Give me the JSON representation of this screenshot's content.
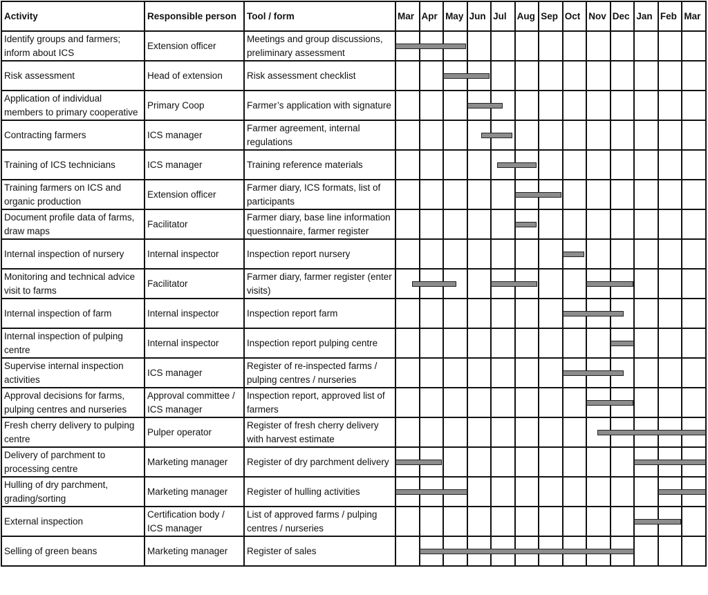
{
  "chart_data": {
    "type": "table",
    "subtype": "gantt",
    "columns": [
      "Activity",
      "Responsible person",
      "Tool / form"
    ],
    "months": [
      "Mar",
      "Apr",
      "May",
      "Jun",
      "Jul",
      "Aug",
      "Sep",
      "Oct",
      "Nov",
      "Dec",
      "Jan",
      "Feb",
      "Mar"
    ],
    "bar_color": "#8c8c8c",
    "rows": [
      {
        "activity": "Identify groups and farmers; inform about ICS",
        "person": "Extension officer",
        "tool": "Meetings and group discussions, preliminary assessment",
        "bars": [
          [
            0,
            2.95
          ]
        ]
      },
      {
        "activity": "Risk assessment",
        "person": "Head of extension",
        "tool": "Risk assessment checklist",
        "bars": [
          [
            2.0,
            3.95
          ]
        ]
      },
      {
        "activity": "Application of individual members to primary cooperative",
        "person": "Primary Coop",
        "tool": "Farmer’s application with signature",
        "bars": [
          [
            3.0,
            4.5
          ]
        ]
      },
      {
        "activity": "Contracting farmers",
        "person": "ICS manager",
        "tool": "Farmer agreement, internal regulations",
        "bars": [
          [
            3.6,
            4.9
          ]
        ]
      },
      {
        "activity": "Training of ICS technicians",
        "person": "ICS manager",
        "tool": "Training reference materials",
        "bars": [
          [
            4.25,
            5.9
          ]
        ]
      },
      {
        "activity": "Training farmers on ICS and organic production",
        "person": "Extension officer",
        "tool": "Farmer diary, ICS formats, list of participants",
        "bars": [
          [
            5.0,
            6.95
          ]
        ]
      },
      {
        "activity": "Document profile data of farms, draw maps",
        "person": "Facilitator",
        "tool": "Farmer diary, base line information questionnaire, farmer register",
        "bars": [
          [
            5.0,
            5.9
          ]
        ]
      },
      {
        "activity": "Internal inspection of nursery",
        "person": "Internal inspector",
        "tool": "Inspection report nursery",
        "bars": [
          [
            7.0,
            7.9
          ]
        ]
      },
      {
        "activity": "Monitoring and technical advice visit to farms",
        "person": "Facilitator",
        "tool": "Farmer diary, farmer register (enter visits)",
        "bars": [
          [
            0.7,
            2.55
          ],
          [
            4.0,
            5.95
          ],
          [
            8.0,
            9.95
          ]
        ]
      },
      {
        "activity": "Internal inspection of farm",
        "person": "Internal inspector",
        "tool": "Inspection report farm",
        "bars": [
          [
            7.0,
            9.55
          ]
        ]
      },
      {
        "activity": "Internal inspection of pulping centre",
        "person": "Internal inspector",
        "tool": "Inspection report pulping centre",
        "bars": [
          [
            9.0,
            10.0
          ]
        ]
      },
      {
        "activity": "Supervise internal inspection activities",
        "person": "ICS manager",
        "tool": "Register of re-inspected farms / pulping centres / nurseries",
        "bars": [
          [
            7.0,
            9.55
          ]
        ]
      },
      {
        "activity": "Approval decisions for farms, pulping centres and nurseries",
        "person": "Approval committee / ICS manager",
        "tool": "Inspection report, approved list of farmers",
        "bars": [
          [
            8.0,
            9.95
          ]
        ]
      },
      {
        "activity": "Fresh cherry delivery to pulping centre",
        "person": "Pulper operator",
        "tool": "Register of fresh cherry delivery with harvest estimate",
        "bars": [
          [
            8.45,
            13.0
          ]
        ]
      },
      {
        "activity": "Delivery of parchment to processing centre",
        "person": "Marketing manager",
        "tool": "Register of dry parchment delivery",
        "bars": [
          [
            0,
            1.95
          ],
          [
            10.0,
            13.0
          ]
        ]
      },
      {
        "activity": "Hulling of dry parchment, grading/sorting",
        "person": "Marketing manager",
        "tool": "Register of hulling activities",
        "bars": [
          [
            0,
            3.0
          ],
          [
            11.0,
            13.0
          ]
        ]
      },
      {
        "activity": "External inspection",
        "person": "Certification body / ICS manager",
        "tool": "List of approved farms / pulping centres / nurseries",
        "bars": [
          [
            10.0,
            11.95
          ]
        ]
      },
      {
        "activity": "Selling of green beans",
        "person": "Marketing manager",
        "tool": "Register of sales",
        "bars": [
          [
            1.0,
            10.0
          ]
        ]
      }
    ]
  }
}
